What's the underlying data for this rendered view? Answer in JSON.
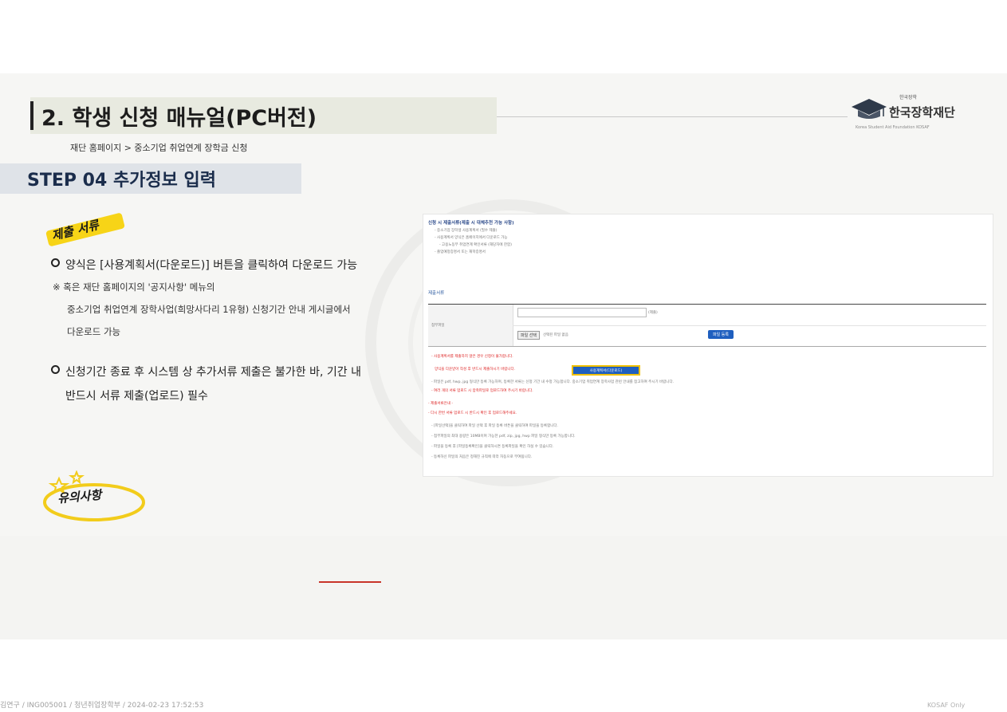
{
  "header": {
    "title": "2. 학생 신청 매뉴얼(PC버전)",
    "subtitle": "재단 홈페이지 > 중소기업 취업연계 장학금 신청",
    "logo_small": "한국장학",
    "logo_main": "한국장학재단",
    "logo_eng": "Korea Student Aid Foundation KOSAF"
  },
  "step": {
    "label": "STEP 04 추가정보 입력"
  },
  "left": {
    "submit_label": "제출 서류",
    "bullet1": "양식은 [사용계획서(다운로드)] 버튼을 클릭하여 다운로드 가능",
    "note1": "※ 혹은 재단 홈페이지의 '공지사항' 메뉴의",
    "note2": "중소기업 취업연계 장학사업(희망사다리 1유형) 신청기간 안내 게시글에서",
    "note3": "다운로드 가능",
    "bullet2_line1": "신청기간 종료 후 시스템 상 추가서류 제출은 불가한 바, 기간 내",
    "bullet2_line2": "반드시 서류 제출(업로드) 필수",
    "caution_label": "유의사항"
  },
  "screenshot": {
    "head": "신청 시 제출서류(제출 시 대체추천 가능 사항)",
    "lines": [
      "- 중소기업 장학생 사용계획서 (필수 제출)",
      "- 사용계획서 양식은 홈페이지에서 다운로드 가능",
      "- 고용노동부 취업연계 확인서류 (해당자에 한함)",
      "- 졸업예정증명서 또는 재학증명서"
    ],
    "section": "제출서류",
    "table_label": "첨부파일",
    "input_suffix": "(제출)",
    "file_button": "파일 선택",
    "file_none": "선택된 파일 없음",
    "register_button": "파일 등록",
    "red1": "- 사용계획서를 제출하지 않은 경우 신청이 불가합니다.",
    "red2": "양식을 다운받아 작성 후 반드시 제출하시기 바랍니다.",
    "download_button": "사용계획서(다운로드)",
    "gray_long": "- 파일은 pdf, hwp, jpg 형식만 등록 가능하며, 등록한 서류는 신청 기간 내 수정 가능합니다. 중소기업 취업연계 장학사업 관련 안내를 참고하여 주시기 바랍니다.",
    "red3": "- 여러 개의 서류 업로드 시 압축파일로 업로드하여 주시기 바랍니다.",
    "red4": "- 제출서류안내 -",
    "red5": "- 다시 한번 서류 업로드 시 반드시 확인 후 업로드해주세요.",
    "gray_list": [
      "- [파일선택]을 클릭하여 파일 선택 후 파일 등록 버튼을 클릭하여 파일을 등록합니다.",
      "- 첨부파일의 최대 용량은 10MB이며 가능한 pdf, zip, jpg, hwp 파일 형식만 등록 가능합니다.",
      "- 파일을 등록 후 [파일등록확인]을 클릭하시면 등록파일을 확인 하실 수 있습니다.",
      "- 등록하신 파일의 처음은 정해진 규칙에 따라 자동으로 부여됩니다."
    ]
  },
  "footer": {
    "left": "김연구 / ING005001 / 청년취업장학부 / 2024-02-23 17:52:53",
    "right": "KOSAF Only"
  },
  "colors": {
    "title_band": "#e8eae0",
    "step_band": "#dfe3e8",
    "step_text": "#1b2d4c",
    "marker_yellow": "#f7d417",
    "button_blue": "#1f5fbf",
    "highlight_yellow": "#f0c000",
    "accent_red": "#c8342a"
  }
}
